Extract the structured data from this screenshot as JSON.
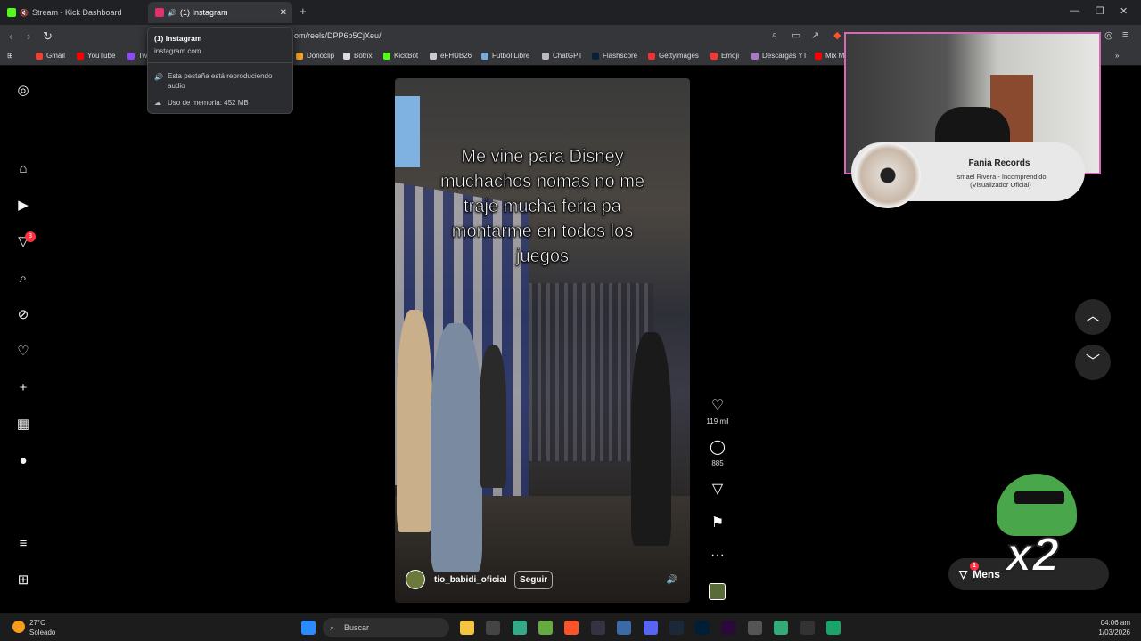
{
  "tabs": [
    {
      "label": "Stream - Kick Dashboard"
    },
    {
      "label": "(1) Instagram"
    }
  ],
  "url": "om/reels/DPP6b5CjXeu/",
  "tooltip": {
    "title": "(1) Instagram",
    "domain": "instagram.com",
    "audio": "Esta pestaña está reproduciendo audio",
    "memory": "Uso de memoria: 452 MB"
  },
  "bookmarks": [
    "Gmail",
    "YouTube",
    "Tw",
    "Donoclip",
    "Botrix",
    "KickBot",
    "eFHUB26",
    "Fútbol Libre",
    "ChatGPT",
    "Flashscore",
    "Gettyimages",
    "Emoji",
    "Descargas YT",
    "Mix M"
  ],
  "sidebar": {
    "notif_count": "3"
  },
  "reel": {
    "caption_lines": [
      "Me vine para Disney",
      "muchachos  nomas no me",
      "traje mucha feria pa",
      "montarme en todos los",
      "juegos"
    ],
    "username": "tio_babidi_oficial",
    "follow_label": "Seguir"
  },
  "actions": {
    "likes": "119 mil",
    "comments": "885"
  },
  "now_playing": {
    "artist": "Fania Records",
    "song": "Ismael Rivera - Incomprendido (Visualizador Oficial)"
  },
  "overlay": {
    "multiplier": "x2"
  },
  "messages": {
    "label": "Mens",
    "badge": "1"
  },
  "taskbar": {
    "temp": "27°C",
    "weather": "Soleado",
    "search": "Buscar",
    "time": "04:06 am",
    "date": "1/03/2026"
  },
  "colors": {
    "accent_pink": "#d46ab5",
    "badge_red": "#ff3040"
  }
}
